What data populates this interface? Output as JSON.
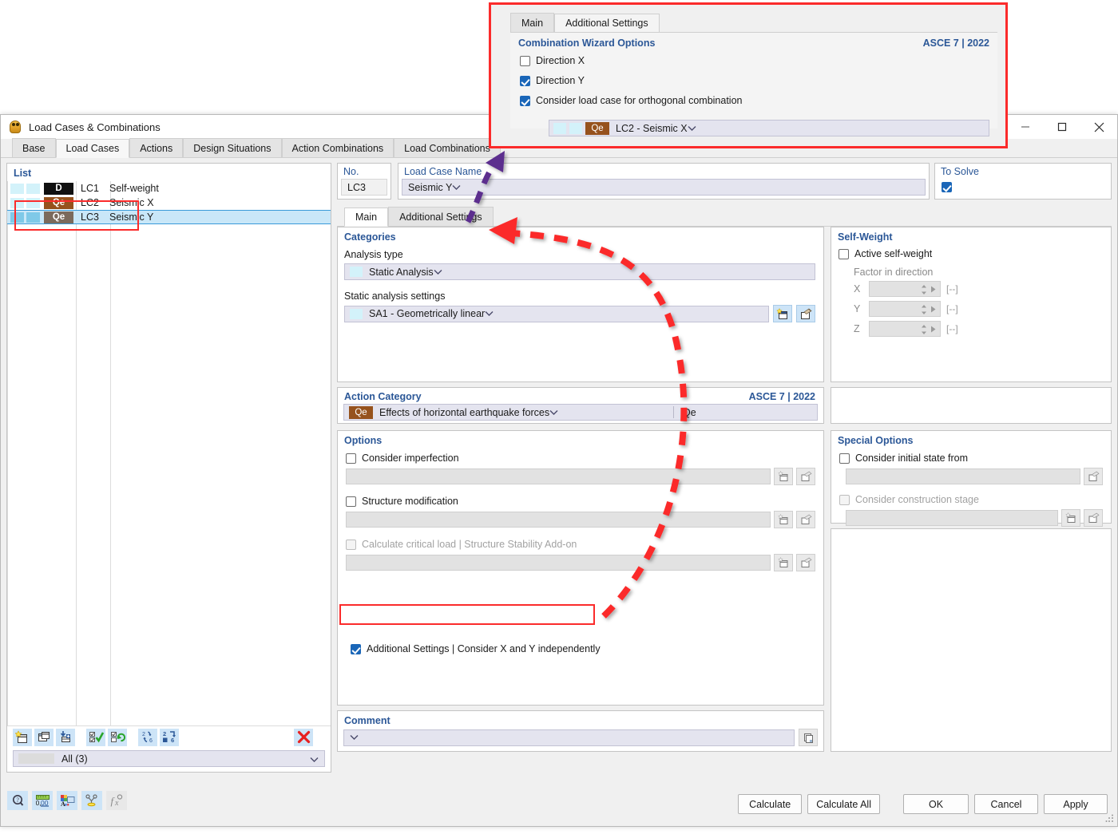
{
  "window": {
    "title": "Load Cases & Combinations",
    "icon": "rfem-load-case-icon",
    "controls": {
      "minimize": "minimize-icon",
      "maximize": "maximize-icon",
      "close": "close-icon"
    }
  },
  "tabs": [
    {
      "label": "Base",
      "active": false
    },
    {
      "label": "Load Cases",
      "active": true
    },
    {
      "label": "Actions",
      "active": false
    },
    {
      "label": "Design Situations",
      "active": false
    },
    {
      "label": "Action Combinations",
      "active": false
    },
    {
      "label": "Load Combinations",
      "active": false
    }
  ],
  "list": {
    "caption": "List",
    "rows": [
      {
        "no": "LC1",
        "name": "Self-weight",
        "tag": "D",
        "tag_color": "#101010",
        "sw1": "#d3f2fa",
        "sw2": "#d3f2fa",
        "selected": false,
        "highlighted": false
      },
      {
        "no": "LC2",
        "name": "Seismic X",
        "tag": "Qe",
        "tag_color": "#96521d",
        "sw1": "#d3f2fa",
        "sw2": "#d3f2fa",
        "selected": false,
        "highlighted": true
      },
      {
        "no": "LC3",
        "name": "Seismic Y",
        "tag": "Qe",
        "tag_color": "#7b6a5c",
        "sw1": "#7fc9e8",
        "sw2": "#7fc9e8",
        "selected": true,
        "highlighted": true
      }
    ],
    "toolbar": [
      {
        "name": "new-load-case-icon",
        "title": "New"
      },
      {
        "name": "copy-load-case-icon",
        "title": "Copy"
      },
      {
        "name": "import-load-case-icon",
        "title": "Import"
      },
      {
        "name": "select-all-icon",
        "title": "Select All"
      },
      {
        "name": "deselect-all-icon",
        "title": "Invert Selection"
      },
      {
        "name": "renumber-icon",
        "title": "Renumber"
      },
      {
        "name": "renumber-sequential-icon",
        "title": "Renumber Sequential"
      },
      {
        "name": "delete-icon",
        "title": "Delete"
      }
    ],
    "filter": {
      "value": "All (3)",
      "swatch": "#dcdcdc"
    }
  },
  "header": {
    "no_label": "No.",
    "no_value": "LC3",
    "name_label": "Load Case Name",
    "name_value": "Seismic Y",
    "to_solve_label": "To Solve",
    "to_solve_checked": true
  },
  "subtabs": [
    {
      "label": "Main",
      "active": true
    },
    {
      "label": "Additional Settings",
      "active": false
    }
  ],
  "categories": {
    "title": "Categories",
    "analysis_type_label": "Analysis type",
    "analysis_type_value": "Static Analysis",
    "analysis_type_swatch": "#d3f2fa",
    "static_settings_label": "Static analysis settings",
    "static_settings_value": "SA1 - Geometrically linear",
    "static_settings_swatch": "#d3f2fa",
    "new_button": "new-settings-icon",
    "edit_button": "edit-settings-icon"
  },
  "action_category": {
    "title": "Action Category",
    "standard": "ASCE 7 | 2022",
    "tag": "Qe",
    "tag_color": "#96521d",
    "value": "Effects of horizontal earthquake forces",
    "short": "Qe"
  },
  "options": {
    "title": "Options",
    "items": [
      {
        "label": "Consider imperfection",
        "checked": false,
        "disabled": false,
        "has_field": true,
        "buttons": [
          "new-icon",
          "edit-icon"
        ]
      },
      {
        "label": "Structure modification",
        "checked": false,
        "disabled": false,
        "has_field": true,
        "buttons": [
          "new-icon",
          "edit-icon"
        ]
      },
      {
        "label": "Calculate critical load | Structure Stability Add-on",
        "checked": false,
        "disabled": true,
        "has_field": true,
        "buttons": [
          "new-icon",
          "edit-icon"
        ]
      }
    ],
    "additional_settings": {
      "label": "Additional Settings | Consider X and Y independently",
      "checked": true,
      "highlighted": true
    }
  },
  "self_weight": {
    "title": "Self-Weight",
    "active_label": "Active self-weight",
    "active_checked": false,
    "factor_label": "Factor in direction",
    "axes": [
      {
        "label": "X",
        "value": "",
        "unit": "[--]"
      },
      {
        "label": "Y",
        "value": "",
        "unit": "[--]"
      },
      {
        "label": "Z",
        "value": "",
        "unit": "[--]"
      }
    ]
  },
  "special_options": {
    "title": "Special Options",
    "items": [
      {
        "label": "Consider initial state from",
        "checked": false,
        "disabled": false,
        "buttons": [
          "edit-icon"
        ]
      },
      {
        "label": "Consider construction stage",
        "checked": false,
        "disabled": true,
        "buttons": [
          "new-icon",
          "edit-icon"
        ]
      }
    ]
  },
  "comment": {
    "title": "Comment",
    "value": "",
    "copy_button": "copy-comment-icon"
  },
  "status_tools": [
    {
      "name": "info-icon",
      "enabled": true
    },
    {
      "name": "units-icon",
      "enabled": true
    },
    {
      "name": "display-properties-icon",
      "enabled": true
    },
    {
      "name": "filter-icon",
      "enabled": true
    },
    {
      "name": "formula-icon",
      "enabled": false
    }
  ],
  "dialog_buttons": [
    {
      "label": "Calculate"
    },
    {
      "label": "Calculate All"
    },
    {
      "label": "OK"
    },
    {
      "label": "Cancel"
    },
    {
      "label": "Apply"
    }
  ],
  "popup": {
    "tabs": [
      {
        "label": "Main",
        "active": false
      },
      {
        "label": "Additional Settings",
        "active": true
      }
    ],
    "group_title": "Combination Wizard Options",
    "standard": "ASCE 7 | 2022",
    "options": [
      {
        "label": "Direction X",
        "checked": false
      },
      {
        "label": "Direction Y",
        "checked": true
      },
      {
        "label": "Consider load case for orthogonal combination",
        "checked": true
      }
    ],
    "load_case_combo": {
      "tag": "Qe",
      "tag_color": "#96521d",
      "sw1": "#d3f2fa",
      "sw2": "#d3f2fa",
      "value": "LC2 - Seismic X"
    }
  },
  "annotations": {
    "highlight_color": "#fb2b2b",
    "arrow_red": "#fb2b2b",
    "arrow_purple": "#5b2d8e"
  }
}
